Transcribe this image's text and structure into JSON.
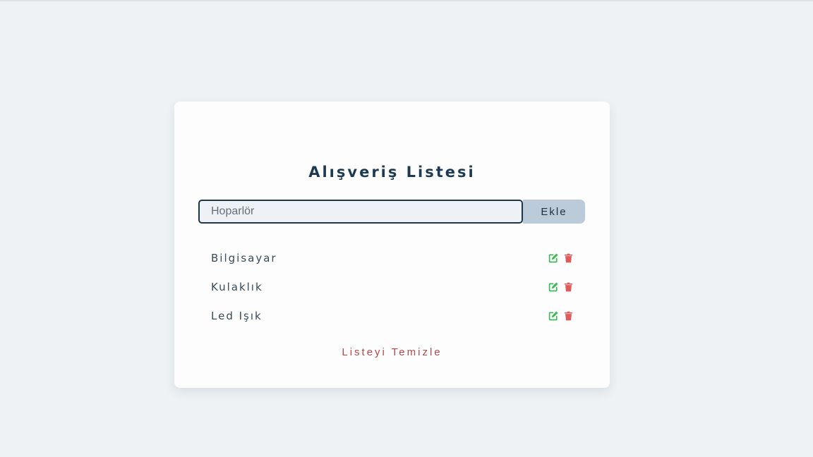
{
  "app": {
    "title": "Alışveriş Listesi"
  },
  "form": {
    "input_value": "Hoparlör",
    "add_label": "Ekle"
  },
  "items": [
    {
      "name": "Bilgisayar",
      "edit_icon": "edit-icon",
      "delete_icon": "trash-icon"
    },
    {
      "name": "Kulaklık",
      "edit_icon": "edit-icon",
      "delete_icon": "trash-icon"
    },
    {
      "name": "Led Işık",
      "edit_icon": "edit-icon",
      "delete_icon": "trash-icon"
    }
  ],
  "clear_label": "Listeyi Temizle",
  "colors": {
    "background": "#eef2f5",
    "card": "#fdfdfd",
    "title": "#1e3a52",
    "input_border": "#1f3547",
    "button": "#bccbda",
    "edit": "#3cba54",
    "delete": "#e05a5a",
    "clear": "#b14a4a"
  }
}
